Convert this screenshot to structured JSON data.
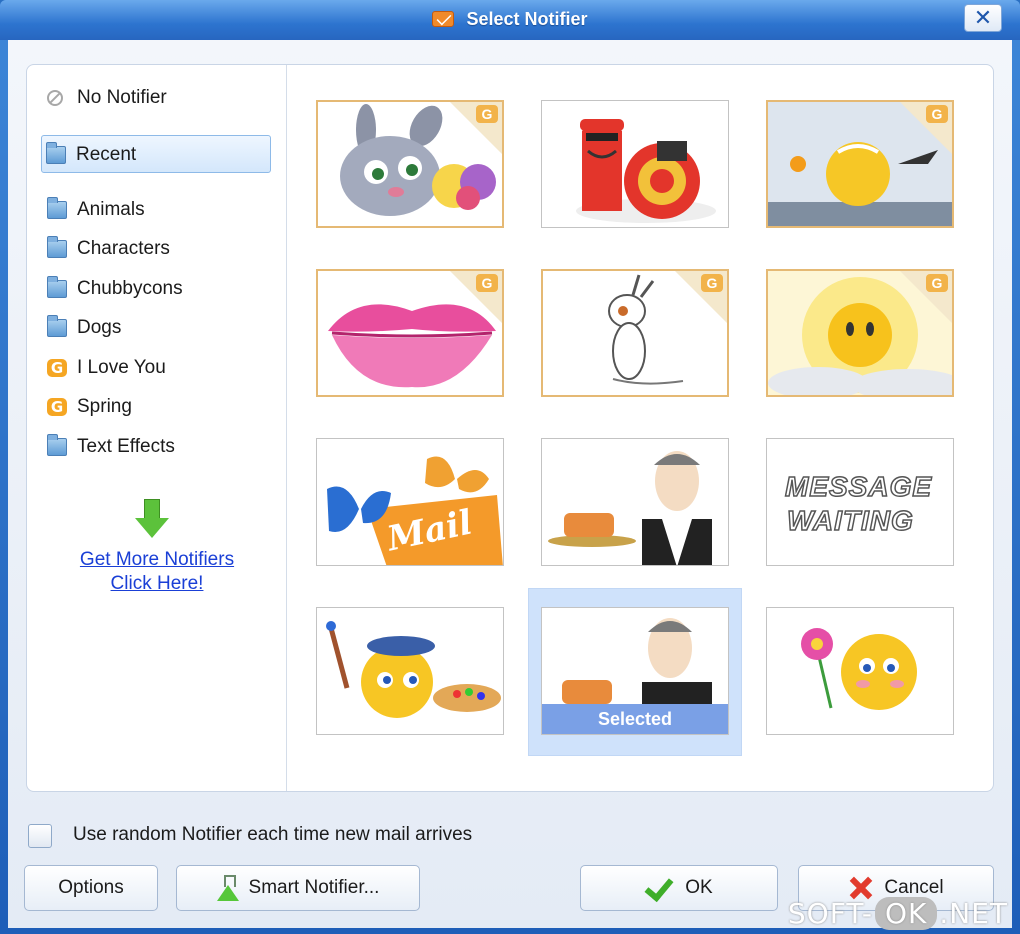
{
  "window": {
    "title": "Select Notifier",
    "close_label": "✕"
  },
  "sidebar": {
    "none_item": "No Notifier",
    "recent_item": "Recent",
    "categories": [
      {
        "label": "Animals",
        "icon": "folder-icon"
      },
      {
        "label": "Characters",
        "icon": "folder-icon"
      },
      {
        "label": "Chubbycons",
        "icon": "folder-icon"
      },
      {
        "label": "Dogs",
        "icon": "folder-icon"
      },
      {
        "label": "I Love You",
        "icon": "g-icon"
      },
      {
        "label": "Spring",
        "icon": "g-icon"
      },
      {
        "label": "Text Effects",
        "icon": "folder-icon"
      }
    ],
    "get_more_link": "Get More Notifiers",
    "click_here_link": "Click Here!"
  },
  "grid": {
    "selected_label": "Selected",
    "message_text_1": "MESSAGE",
    "message_text_2": "WAITING",
    "mail_text": "Mail",
    "g_badge": "G"
  },
  "options": {
    "random_label": "Use random Notifier each time new mail arrives",
    "random_checked": false
  },
  "buttons": {
    "options": "Options",
    "smart_notifier": "Smart Notifier...",
    "ok": "OK",
    "cancel": "Cancel"
  },
  "watermark": {
    "prefix": "SOFT-",
    "pill": "OK",
    "suffix": ".NET"
  },
  "colors": {
    "title_bar": "#2d74cf",
    "selection_band": "#7aa0e6",
    "link": "#1a3fd6",
    "gold_border": "#e5b974"
  }
}
